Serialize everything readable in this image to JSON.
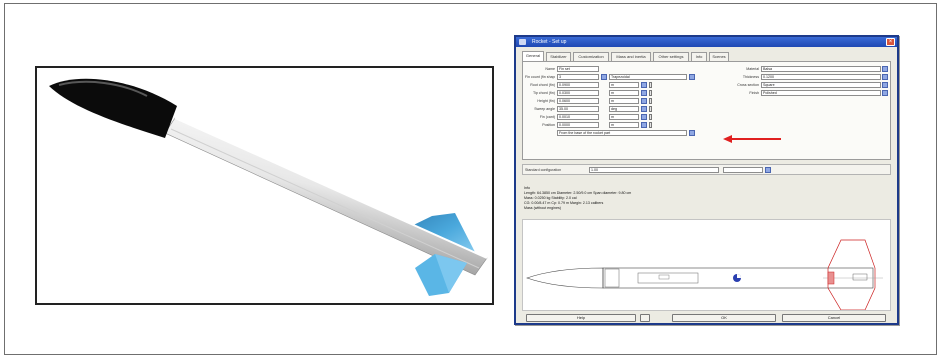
{
  "dialog": {
    "title": "Rocket - Set up",
    "tabs": [
      {
        "label": "General"
      },
      {
        "label": "Stabilizer"
      },
      {
        "label": "Customization"
      },
      {
        "label": "Mass and inertia"
      },
      {
        "label": "Other settings"
      },
      {
        "label": "Info"
      },
      {
        "label": "Scenes"
      }
    ],
    "left_fields": [
      {
        "label": "Name",
        "value": "Fin set",
        "unit": ""
      },
      {
        "label": "Fin count (fin shape)",
        "value": "3",
        "unit": "Trapezoidal"
      },
      {
        "label": "Root chord (fin)",
        "value": "0.0900",
        "unit": "m"
      },
      {
        "label": "Tip chord (fin)",
        "value": "0.0300",
        "unit": "m"
      },
      {
        "label": "Height (fin)",
        "value": "0.0600",
        "unit": "m"
      },
      {
        "label": "Sweep angle",
        "value": "35.00",
        "unit": "deg"
      },
      {
        "label": "Fin (cant)",
        "value": "0.0010",
        "unit": "m"
      },
      {
        "label": "Position",
        "value": "0.0000",
        "unit": "m"
      },
      {
        "label": "",
        "value": "From the base of the rocket part",
        "unit": ""
      }
    ],
    "right_fields": [
      {
        "label": "Material",
        "value": "Balsa"
      },
      {
        "label": "Thickness",
        "value": "0.1200"
      },
      {
        "label": "Cross section",
        "value": "Square"
      },
      {
        "label": "Finish",
        "value": "Polished"
      }
    ],
    "sub_panel": {
      "label": "Standard configuration",
      "value": "1.00"
    },
    "info": {
      "heading": "Info",
      "lines": [
        "Length: 64.3850 cm   Diameter: 2.50/9.0 cm   Span diameter: 9.80 cm",
        "Mass: 0.0250 kg   Stability: 2.0 cal",
        "CG: 0.00/8.47 m   Cp: 0.79 m   Margin: 2.13 calibers",
        "Mass (without engines)"
      ]
    },
    "buttons": {
      "help": "Help",
      "ok": "OK",
      "cancel": "Cancel"
    }
  },
  "colors": {
    "titlebar": "#1f48b3",
    "fin": "#4aa8dc",
    "nose": "#0b0b0b",
    "arrow": "#e02020",
    "cp_marker": "#cc2020"
  }
}
